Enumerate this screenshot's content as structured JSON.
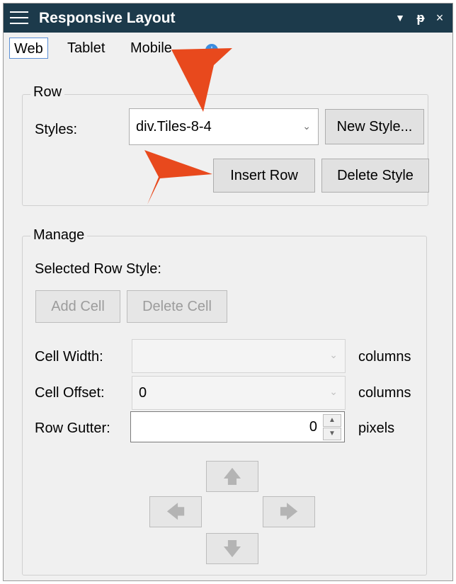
{
  "window": {
    "title": "Responsive Layout",
    "menu_icon": "hamburger-icon",
    "dropdown_icon": "▼",
    "pin_icon": "ᵽ",
    "close_icon": "×"
  },
  "tabs": [
    {
      "label": "Web",
      "active": true
    },
    {
      "label": "Tablet",
      "active": false
    },
    {
      "label": "Mobile",
      "active": false
    }
  ],
  "row_group": {
    "legend": "Row",
    "styles_label": "Styles:",
    "styles_value": "div.Tiles-8-4",
    "new_style_label": "New Style...",
    "insert_row_label": "Insert Row",
    "delete_style_label": "Delete Style"
  },
  "manage_group": {
    "legend": "Manage",
    "selected_row_style_label": "Selected Row Style:",
    "add_cell_label": "Add Cell",
    "delete_cell_label": "Delete Cell",
    "cell_width_label": "Cell Width:",
    "cell_width_value": "",
    "cell_width_unit": "columns",
    "cell_offset_label": "Cell Offset:",
    "cell_offset_value": "0",
    "cell_offset_unit": "columns",
    "row_gutter_label": "Row Gutter:",
    "row_gutter_value": "0",
    "row_gutter_unit": "pixels"
  },
  "colors": {
    "titlebar": "#1c3a4b",
    "callout": "#e8491d",
    "active_tab_border": "#5b8fd6"
  }
}
